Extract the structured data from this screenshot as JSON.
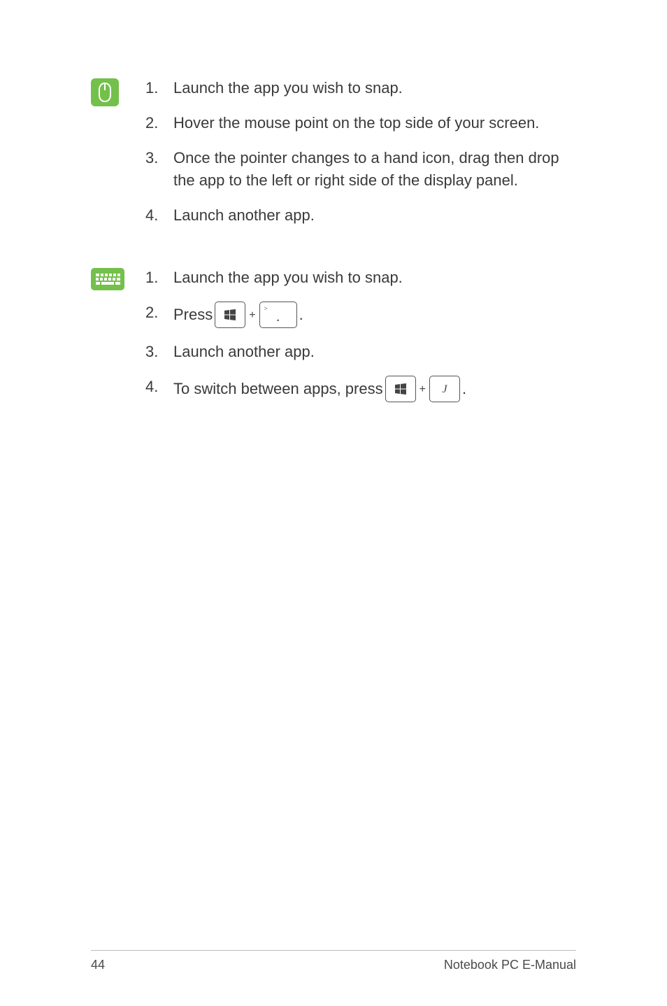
{
  "section_mouse": {
    "items": [
      {
        "num": "1.",
        "text": "Launch the app you wish to snap."
      },
      {
        "num": "2.",
        "text": "Hover the mouse point on the top side of your screen."
      },
      {
        "num": "3.",
        "text": "Once the pointer changes to a hand icon, drag then drop the app to the left or right side of the display panel."
      },
      {
        "num": "4.",
        "text": "Launch another app."
      }
    ]
  },
  "section_keyboard": {
    "items": [
      {
        "num": "1.",
        "text": "Launch the app you wish to snap."
      },
      {
        "num": "2.",
        "prefix": "Press ",
        "suffix": "."
      },
      {
        "num": "3.",
        "text": "Launch another app."
      },
      {
        "num": "4.",
        "prefix": "To switch between apps, press ",
        "suffix": "."
      }
    ],
    "key_period_sup": ">",
    "key_period_main": ".",
    "key_j": "J"
  },
  "footer": {
    "page": "44",
    "title": "Notebook PC E-Manual"
  }
}
